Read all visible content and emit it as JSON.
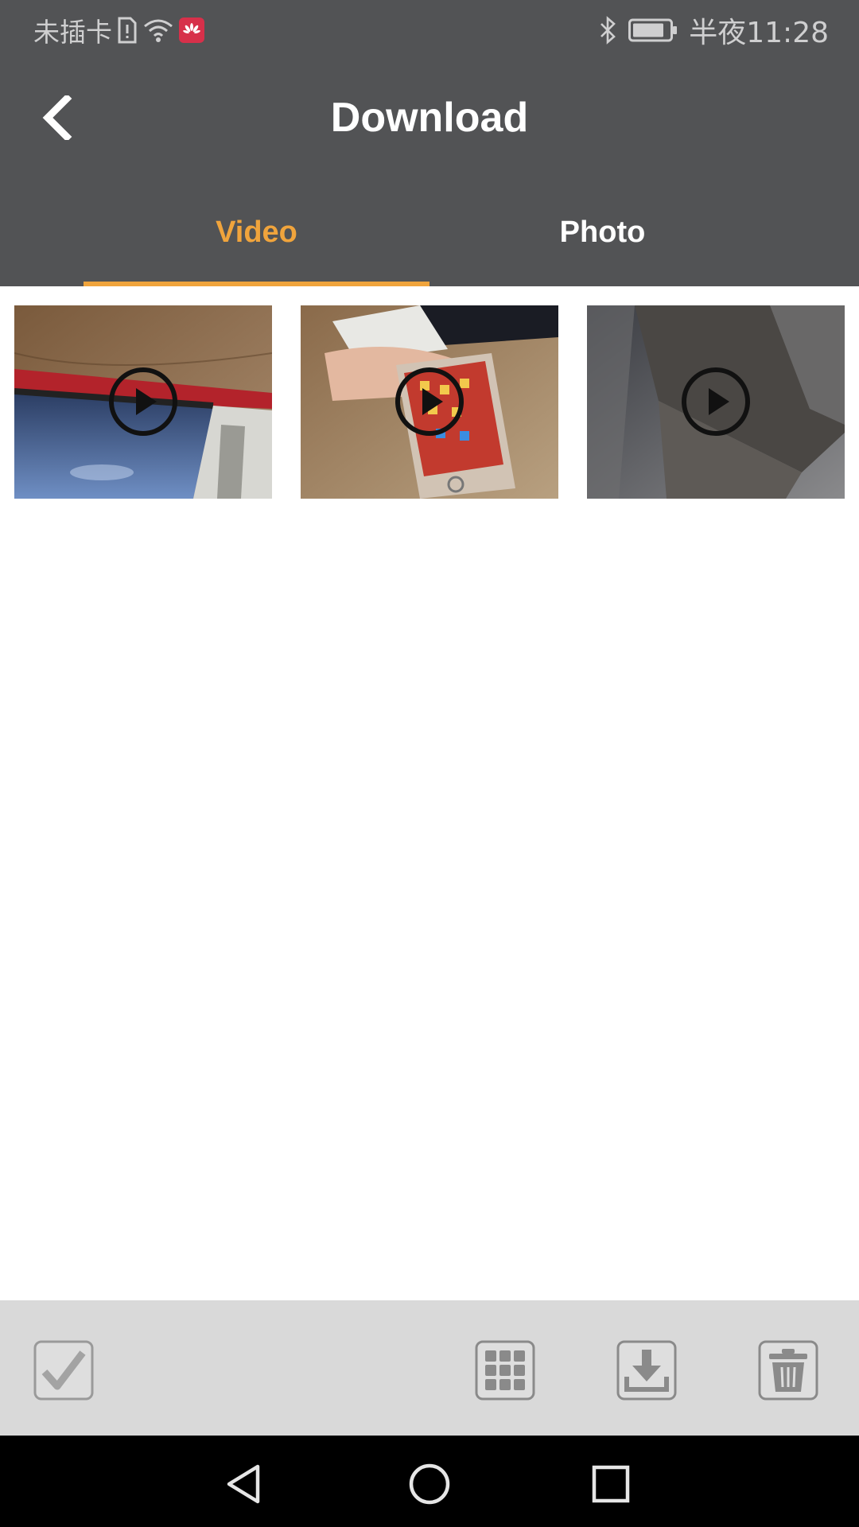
{
  "status_bar": {
    "carrier": "未插卡",
    "time": "半夜11:28",
    "icons": [
      "sim-alert-icon",
      "wifi-icon",
      "huawei-app-icon",
      "bluetooth-icon",
      "battery-icon"
    ]
  },
  "app_bar": {
    "title": "Download",
    "back_icon": "chevron-left-icon"
  },
  "tabs": [
    {
      "label": "Video",
      "active": true
    },
    {
      "label": "Photo",
      "active": false
    }
  ],
  "colors": {
    "bar_bg": "#525355",
    "accent": "#f0a43c",
    "toolbar_bg": "#d9d9d9",
    "toolbar_icon": "#8a8a8a"
  },
  "videos": [
    {
      "thumbnail": "desk-laptop-scene",
      "overlay_icon": "play-circle-icon"
    },
    {
      "thumbnail": "hand-holding-phone-scene",
      "overlay_icon": "play-circle-icon"
    },
    {
      "thumbnail": "dark-surface-scene",
      "overlay_icon": "play-circle-icon"
    }
  ],
  "toolbar": {
    "icons": [
      "checkbox-icon",
      "grid-icon",
      "download-icon",
      "trash-icon"
    ]
  },
  "nav_bar": {
    "icons": [
      "nav-back-icon",
      "nav-home-icon",
      "nav-recent-icon"
    ]
  }
}
